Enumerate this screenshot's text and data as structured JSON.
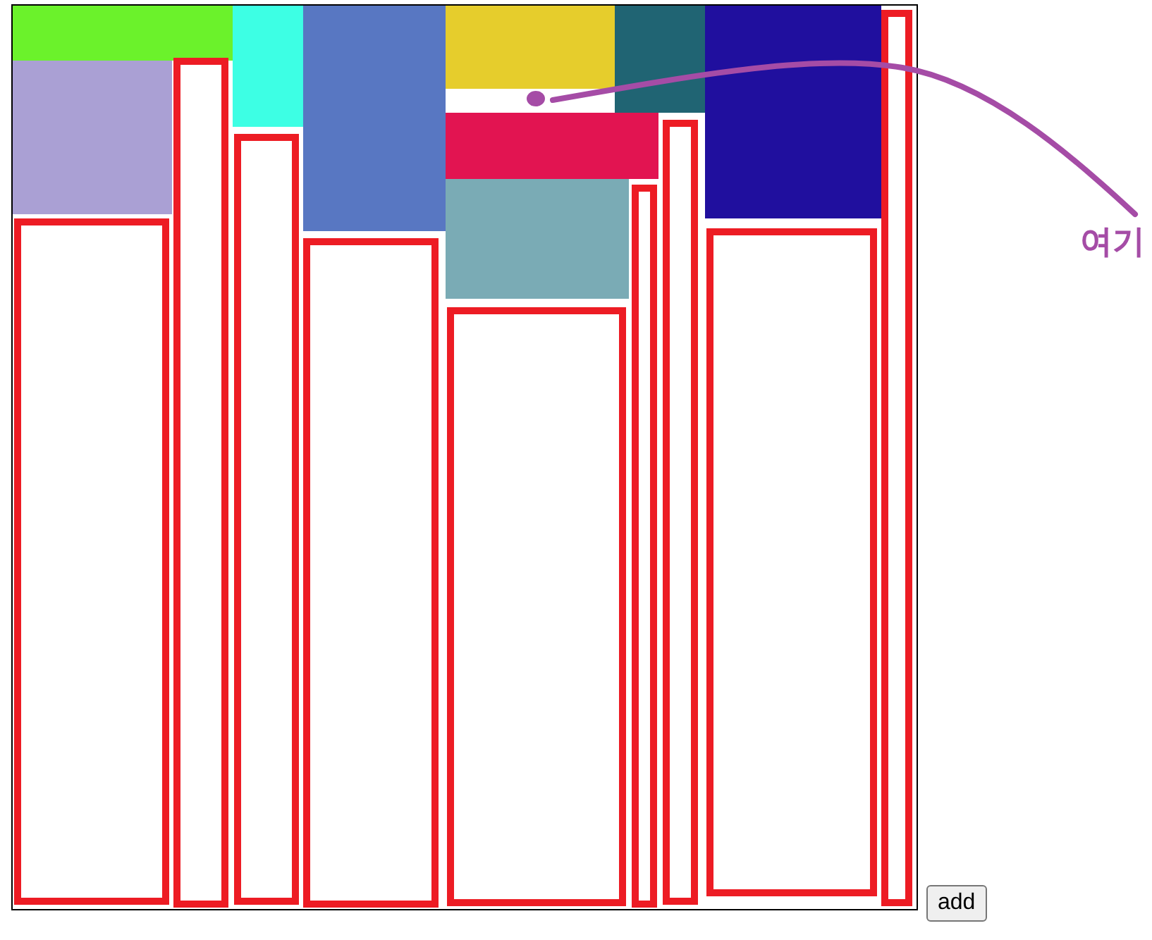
{
  "canvas": {
    "blocks": [
      {
        "kind": "tile",
        "color": "#6bf22b"
      },
      {
        "kind": "tile",
        "color": "#3dffe4"
      },
      {
        "kind": "tile",
        "color": "#5877c2"
      },
      {
        "kind": "tile",
        "color": "#e6cd2c"
      },
      {
        "kind": "tile",
        "color": "#206473"
      },
      {
        "kind": "tile",
        "color": "#200f9e"
      },
      {
        "kind": "frame"
      },
      {
        "kind": "frame"
      },
      {
        "kind": "tile",
        "color": "#aaa0d4"
      },
      {
        "kind": "tile",
        "color": "#e21451"
      },
      {
        "kind": "frame"
      },
      {
        "kind": "frame"
      },
      {
        "kind": "tile",
        "color": "#7aabb5"
      },
      {
        "kind": "frame"
      },
      {
        "kind": "frame"
      },
      {
        "kind": "frame"
      },
      {
        "kind": "frame"
      },
      {
        "kind": "frame"
      }
    ]
  },
  "annotation": {
    "text": "여기"
  },
  "add_button": {
    "label": "add"
  }
}
